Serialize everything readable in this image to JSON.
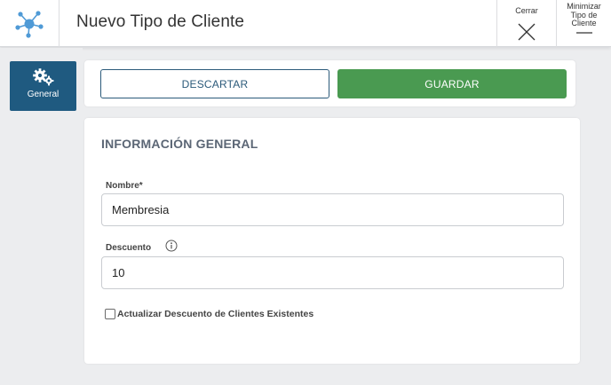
{
  "header": {
    "title": "Nuevo Tipo de Cliente",
    "logo_icon": "network-hub-icon",
    "close_label": "Cerrar",
    "minimize_label": "Minimizar Tipo de Cliente"
  },
  "sidebar": {
    "items": [
      {
        "label": "General",
        "icon": "gears-icon",
        "active": true
      }
    ]
  },
  "actions": {
    "discard_label": "DESCARTAR",
    "save_label": "GUARDAR"
  },
  "form": {
    "section_title": "INFORMACIÓN GENERAL",
    "nombre": {
      "label": "Nombre*",
      "value": "Membresia"
    },
    "descuento": {
      "label": "Descuento",
      "value": "10"
    },
    "update_existing": {
      "label": "Actualizar Descuento de Clientes Existentes",
      "checked": false
    }
  },
  "colors": {
    "header_bg": "#ffffff",
    "page_bg": "#ecedef",
    "rail_active": "#1f5a80",
    "save_green": "#4a9a51",
    "discard_border": "#2b5a7a",
    "logo_blue": "#4f9ad6"
  }
}
